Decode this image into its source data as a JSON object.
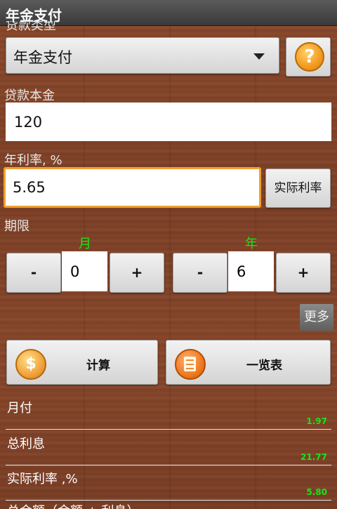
{
  "app": {
    "title": "年金支付"
  },
  "loan_type": {
    "label": "贷款类型",
    "selected": "年金支付"
  },
  "principal": {
    "label": "贷款本金",
    "value": "120"
  },
  "rate": {
    "label": "年利率, %",
    "value": "5.65",
    "effective_button": "实际利率"
  },
  "term": {
    "label": "期限",
    "months": {
      "label": "月",
      "value": "0",
      "minus": "-",
      "plus": "+"
    },
    "years": {
      "label": "年",
      "value": "6",
      "minus": "-",
      "plus": "+"
    }
  },
  "more_button": "更多",
  "actions": {
    "calculate": "计算",
    "schedule": "一览表"
  },
  "results": [
    {
      "label": "月付",
      "value": "1.97"
    },
    {
      "label": "总利息",
      "value": "21.77"
    },
    {
      "label": "实际利率 ,%",
      "value": "5.80"
    }
  ],
  "results_truncated_label": "总金额（金额 + 利息）",
  "colors": {
    "accent_green": "#16e616",
    "focus_orange": "#f0a030"
  }
}
